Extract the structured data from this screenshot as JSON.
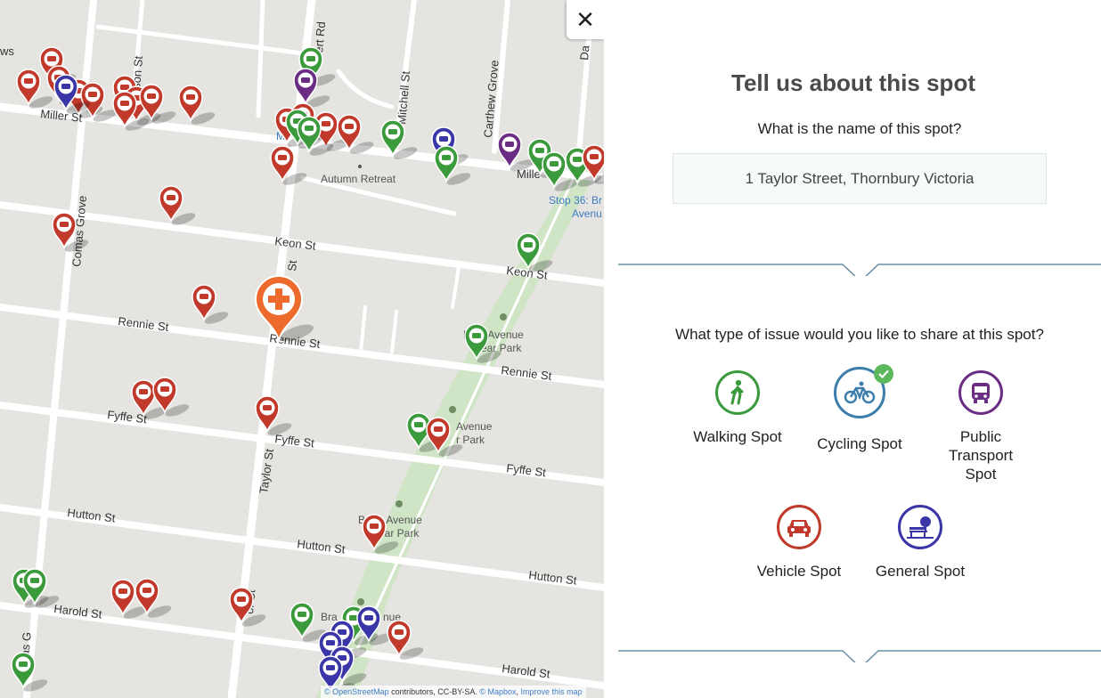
{
  "map": {
    "streets": [
      "Miller St",
      "Keon St",
      "Rennie St",
      "Fyffe St",
      "Hutton St",
      "Harold St",
      "Taylor St",
      "Mitchell St",
      "Carthew Grove",
      "Comas Grove",
      "Comas G",
      "Fyffe St",
      "Rennie St",
      "Keon St",
      "Hutton St",
      "Harold St",
      "Fyffe St",
      "Rennie St",
      "Fyffe St",
      "Hutton St",
      "Harold St",
      "ert Rd",
      "son St",
      "ws",
      "St",
      "or St",
      "Taylor St",
      "Mille",
      "Da"
    ],
    "pois": [
      "Autumn Retreat",
      "Stop 36: Br",
      "Avenu",
      "B     en Avenue",
      "ear Park",
      "Avenue",
      "r Park",
      "Br     en Avenue",
      "ear Park",
      "Bra",
      "nue",
      "M"
    ],
    "close_icon_char": "✕",
    "attribution": {
      "osm": "© OpenStreetMap",
      "contributors": " contributors, CC-BY-SA. ",
      "mapbox": "© Mapbox",
      "improve": "Improve this map"
    },
    "selected_marker": "medical-cross",
    "colors": {
      "walking": "#3b9a3b",
      "cycling": "#3c7dab",
      "transport": "#6b2d84",
      "vehicle": "#c0392b",
      "general": "#3a36a8",
      "selected": "#ee6a2c"
    }
  },
  "panel": {
    "title": "Tell us about this spot",
    "name_question": "What is the name of this spot?",
    "name_value": "1 Taylor Street, Thornbury Victoria",
    "type_question": "What type of issue would you like to share at this spot?",
    "types": [
      {
        "label": "Walking Spot",
        "icon": "walking-icon",
        "color": "#3b9a3b",
        "selected": false
      },
      {
        "label": "Cycling Spot",
        "icon": "bicycle-icon",
        "color": "#3c7dab",
        "selected": true
      },
      {
        "label": "Public Transport Spot",
        "icon": "bus-icon",
        "color": "#6b2d84",
        "selected": false
      },
      {
        "label": "Vehicle Spot",
        "icon": "car-icon",
        "color": "#c0392b",
        "selected": false
      },
      {
        "label": "General Spot",
        "icon": "park-bench-icon",
        "color": "#3a36a8",
        "selected": false
      }
    ]
  }
}
